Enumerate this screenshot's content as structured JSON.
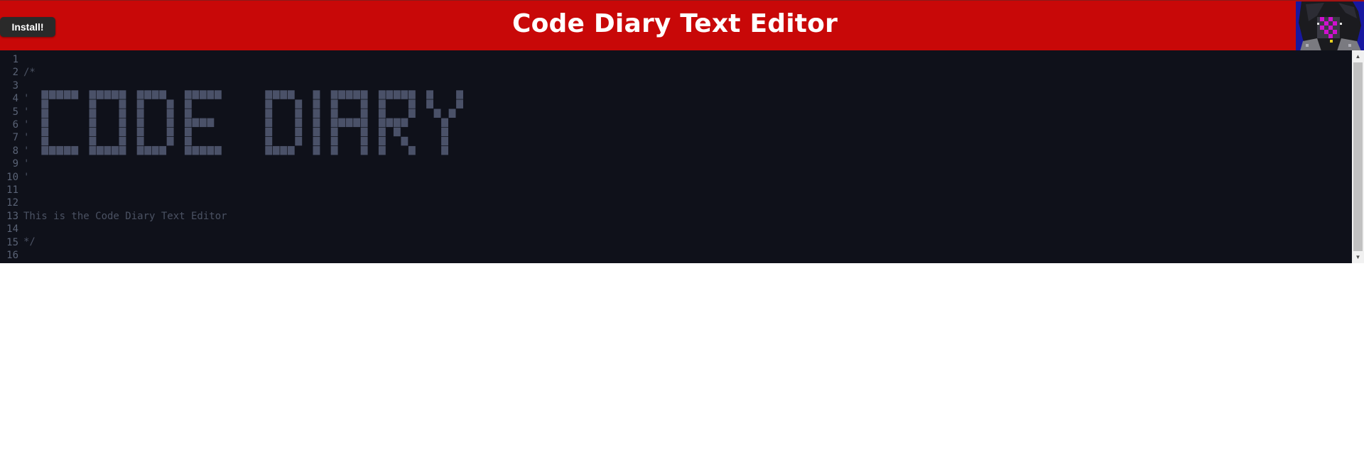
{
  "header": {
    "install_label": "Install!",
    "title": "Code Diary Text Editor",
    "background_color": "#c80808",
    "avatar_icon": "pixel-avatar-icon"
  },
  "editor": {
    "background_color": "#0f111a",
    "line_numbers": [
      "1",
      "2",
      "3",
      "4",
      "5",
      "6",
      "7",
      "8",
      "9",
      "10",
      "11",
      "12",
      "13",
      "14",
      "15",
      "16"
    ],
    "lines": [
      "",
      "/*",
      "",
      "'",
      "'",
      "'",
      "'",
      "'",
      "'",
      "'",
      "",
      "",
      "This is the Code Diary Text Editor",
      "",
      "*/",
      ""
    ],
    "ascii_art_text": "CODE DIARY",
    "ascii_art_color": "#4a5168"
  },
  "scrollbar": {
    "up_icon": "scroll-up-arrow-icon",
    "down_icon": "scroll-down-arrow-icon"
  }
}
